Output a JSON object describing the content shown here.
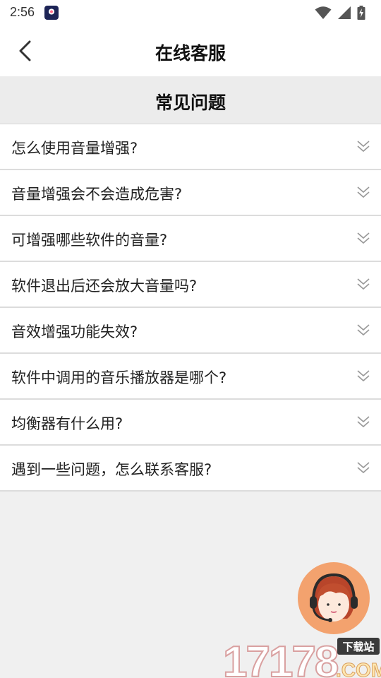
{
  "status_bar": {
    "time": "2:56",
    "icons": [
      "app-badge-icon",
      "wifi-icon",
      "signal-icon",
      "battery-charging-icon"
    ]
  },
  "header": {
    "title": "在线客服",
    "back_icon": "chevron-left-icon"
  },
  "section": {
    "title": "常见问题"
  },
  "faq": [
    {
      "question": "怎么使用音量增强?"
    },
    {
      "question": "音量增强会不会造成危害?"
    },
    {
      "question": "可增强哪些软件的音量?"
    },
    {
      "question": "软件退出后还会放大音量吗?"
    },
    {
      "question": "音效增强功能失效?"
    },
    {
      "question": "软件中调用的音乐播放器是哪个?"
    },
    {
      "question": "均衡器有什么用?"
    },
    {
      "question": "遇到一些问题，怎么联系客服?"
    }
  ],
  "expand_icon": "double-chevron-down-icon",
  "support_button": {
    "icon": "customer-service-agent-icon"
  },
  "watermark": {
    "text": "17178",
    "suffix": ".COM",
    "badge": "下载站"
  },
  "colors": {
    "background": "#f0f0f0",
    "surface": "#ffffff",
    "divider": "#dcdcdc",
    "support_accent": "#f3a26e"
  }
}
